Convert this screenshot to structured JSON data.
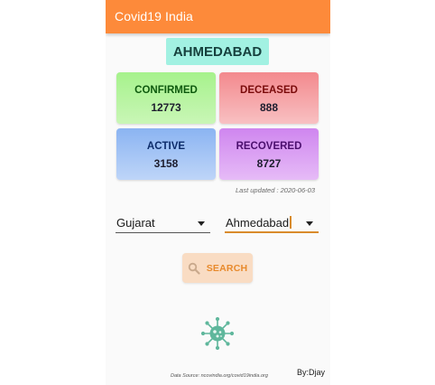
{
  "app": {
    "title": "Covid19 India",
    "accent_color": "#fd8a3a"
  },
  "city_title": "AHMEDABAD",
  "stats": {
    "confirmed": {
      "label": "CONFIRMED",
      "value": "12773"
    },
    "deceased": {
      "label": "DECEASED",
      "value": "888"
    },
    "active": {
      "label": "ACTIVE",
      "value": "3158"
    },
    "recovered": {
      "label": "RECOVERED",
      "value": "8727"
    }
  },
  "last_updated": "Last updated : 2020-06-03",
  "filters": {
    "state": {
      "selected": "Gujarat",
      "icon": "chevron-down-icon"
    },
    "city": {
      "selected": "Ahmedabad",
      "icon": "chevron-down-icon"
    }
  },
  "search": {
    "label": "SEARCH",
    "icon": "search-icon"
  },
  "virus_icon": "virus-icon",
  "footer": {
    "credits": "Data Source: ncovindia.org/covid19india.org",
    "author": "By:Djay"
  }
}
